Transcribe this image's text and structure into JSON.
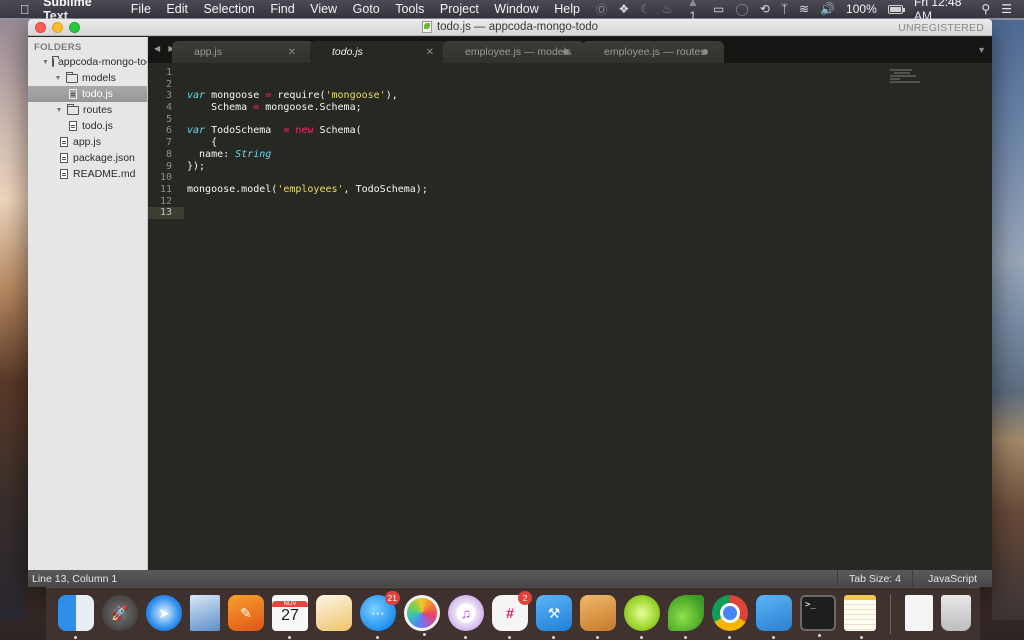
{
  "menubar": {
    "apple_icon": "apple-logo",
    "app_name": "Sublime Text",
    "menus": [
      "File",
      "Edit",
      "Selection",
      "Find",
      "View",
      "Goto",
      "Tools",
      "Project",
      "Window",
      "Help"
    ],
    "status": {
      "adobe_count": "1",
      "battery": "100%",
      "clock": "Fri 12:48 AM"
    }
  },
  "window": {
    "title": "todo.js — appcoda-mongo-todo",
    "license": "UNREGISTERED"
  },
  "sidebar": {
    "header": "FOLDERS",
    "items": [
      {
        "label": "appcoda-mongo-todo",
        "type": "folder",
        "depth": 0,
        "expanded": true
      },
      {
        "label": "models",
        "type": "folder",
        "depth": 1,
        "expanded": true
      },
      {
        "label": "todo.js",
        "type": "file",
        "depth": 2,
        "selected": true
      },
      {
        "label": "routes",
        "type": "folder",
        "depth": 1,
        "expanded": true
      },
      {
        "label": "todo.js",
        "type": "file",
        "depth": 2
      },
      {
        "label": "app.js",
        "type": "file",
        "depth": 1
      },
      {
        "label": "package.json",
        "type": "file",
        "depth": 1
      },
      {
        "label": "README.md",
        "type": "file",
        "depth": 1
      }
    ]
  },
  "tabs": [
    {
      "label": "app.js",
      "active": false,
      "modified": false
    },
    {
      "label": "todo.js",
      "active": true,
      "modified": false
    },
    {
      "label": "employee.js — models",
      "active": false,
      "modified": true
    },
    {
      "label": "employee.js — routes",
      "active": false,
      "modified": true
    }
  ],
  "editor": {
    "line_numbers": [
      "1",
      "2",
      "3",
      "4",
      "5",
      "6",
      "7",
      "8",
      "9",
      "10",
      "11",
      "12",
      "13"
    ],
    "current_line": 13,
    "code_lines": [
      "",
      "",
      "var mongoose = require('mongoose'),",
      "    Schema = mongoose.Schema;",
      "",
      "var TodoSchema  = new Schema(",
      "    {",
      "  name: String",
      "});",
      "",
      "mongoose.model('employees', TodoSchema);",
      "",
      ""
    ],
    "tokens": {
      "var": "var",
      "mongoose": " mongoose ",
      "eq": "=",
      "require": " require(",
      "str_mongoose": "'mongoose'",
      "close_comma": "),",
      "schema_indent": "    Schema ",
      "schema_rhs": " mongoose.Schema;",
      "todoschema": " TodoSchema  ",
      "new": "new",
      "schema_call": " Schema(",
      "brace_open": "    {",
      "name_key": "  name: ",
      "String": "String",
      "close": "});",
      "model_call": "mongoose.model(",
      "str_employees": "'employees'",
      "model_rest": ", TodoSchema);"
    }
  },
  "statusbar": {
    "position": "Line 13, Column 1",
    "tab_size": "Tab Size: 4",
    "syntax": "JavaScript"
  },
  "dock": {
    "apps": [
      {
        "name": "Finder",
        "running": true
      },
      {
        "name": "Launchpad",
        "running": false
      },
      {
        "name": "Safari",
        "running": false
      },
      {
        "name": "Mail",
        "running": false
      },
      {
        "name": "Pages",
        "running": false
      },
      {
        "name": "Calendar",
        "running": true,
        "month": "NOV",
        "day": "27"
      },
      {
        "name": "Pages Document",
        "running": false
      },
      {
        "name": "Messages",
        "running": true,
        "badge": "21"
      },
      {
        "name": "Photos",
        "running": true
      },
      {
        "name": "iTunes",
        "running": true
      },
      {
        "name": "Slack",
        "running": true,
        "badge": "2"
      },
      {
        "name": "Xcode",
        "running": true
      },
      {
        "name": "Preview",
        "running": true
      },
      {
        "name": "Lime",
        "running": true
      },
      {
        "name": "Leaf",
        "running": true
      },
      {
        "name": "Chrome",
        "running": true
      },
      {
        "name": "Simulator",
        "running": true
      },
      {
        "name": "Terminal",
        "running": true,
        "prompt": ">_"
      },
      {
        "name": "Notes",
        "running": true
      },
      {
        "name": "Documents",
        "running": false
      },
      {
        "name": "Trash",
        "running": false
      }
    ]
  },
  "colors": {
    "editor_bg": "#272822",
    "keyword": "#66d9ef",
    "operator": "#f92672",
    "string": "#e6db74",
    "sidebar_bg": "#e6e6e6"
  }
}
